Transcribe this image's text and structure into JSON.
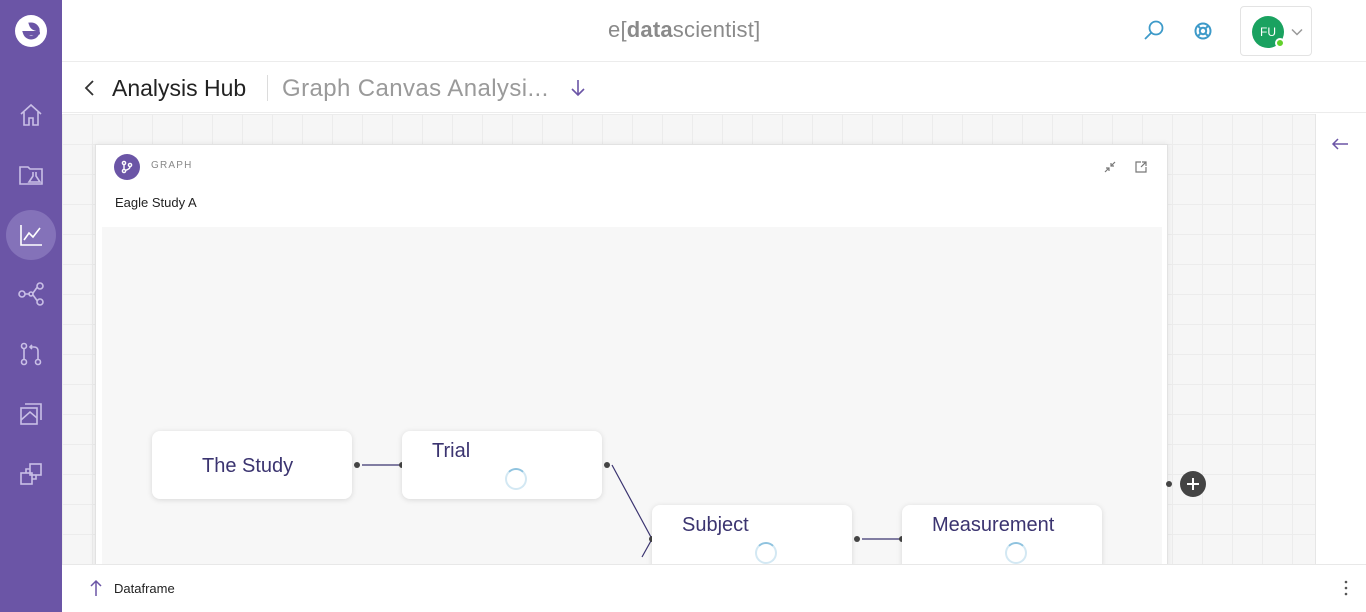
{
  "brand": {
    "prefix": "e",
    "open_bracket": "[",
    "bold": "data",
    "rest": "scientist",
    "close_bracket": "]"
  },
  "user": {
    "initials": "FU",
    "status_color": "#62d12a",
    "avatar_color": "#1aa260"
  },
  "sidebar": {
    "background": "#6b55a6",
    "items": [
      {
        "icon": "home-icon"
      },
      {
        "icon": "lab-folder-icon"
      },
      {
        "icon": "chart-line-icon",
        "active": true
      },
      {
        "icon": "share-graph-icon"
      },
      {
        "icon": "merge-icon"
      },
      {
        "icon": "layers-icon"
      },
      {
        "icon": "stack-icon"
      }
    ]
  },
  "breadcrumb": {
    "title": "Analysis Hub",
    "subtitle": "Graph Canvas Analysi..."
  },
  "card": {
    "type_label": "GRAPH",
    "title": "Eagle Study A"
  },
  "graph": {
    "nodes": [
      {
        "label": "The Study",
        "loading": false
      },
      {
        "label": "Trial",
        "loading": true
      },
      {
        "label": "Subject",
        "loading": true
      },
      {
        "label": "Measurement",
        "loading": true
      }
    ],
    "edges": [
      [
        "The Study",
        "Trial"
      ],
      [
        "Trial",
        "Subject"
      ],
      [
        "Subject",
        "Measurement"
      ]
    ],
    "edge_color": "#3b3470"
  },
  "bottombar": {
    "label": "Dataframe"
  }
}
